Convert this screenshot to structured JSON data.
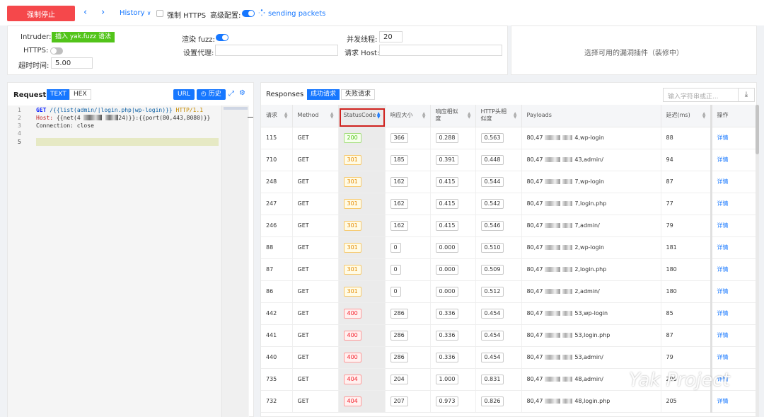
{
  "topbar": {
    "stop_label": "强制停止",
    "history_label": "History",
    "force_https_label": "强制 HTTPS",
    "advanced_label": "高级配置:",
    "sending_label": "sending packets"
  },
  "config": {
    "intruder_label": "Intruder:",
    "intruder_tag": "插入 yak.fuzz 语法",
    "https_label": "HTTPS:",
    "timeout_label": "超时时间:",
    "timeout_value": "5.00",
    "render_fuzz_label": "渲染 fuzz:",
    "proxy_label": "设置代理:",
    "proxy_value": "",
    "threads_label": "并发线程:",
    "threads_value": "20",
    "host_label": "请求 Host:",
    "host_value": "",
    "plugin_placeholder": "选择可用的漏洞插件（装修中）"
  },
  "request": {
    "title": "Request",
    "text_tab": "TEXT",
    "hex_tab": "HEX",
    "url_button": "URL",
    "history_button": "历史",
    "line_numbers": [
      "1",
      "2",
      "3",
      "4",
      "5"
    ],
    "line1_method": "GET",
    "line1_path": "/{{list(admin/|login.php|wp-login)}}",
    "line1_proto": "HTTP/1.1",
    "line2_key": "Host:",
    "line2_a": "{{net(4",
    "line2_b": "24)}}:{{port(80,443,8080)}}",
    "line3": "Connection: close"
  },
  "responses": {
    "title": "Responses",
    "success_tab": "成功请求",
    "fail_tab": "失败请求",
    "search_placeholder": "输入字符串或正...",
    "columns": [
      "请求",
      "Method",
      "StatusCode",
      "响应大小",
      "响应相似度",
      "HTTP头相似度",
      "Payloads",
      "延迟(ms)",
      "操作"
    ],
    "detail_label": "详情",
    "rows": [
      {
        "id": "115",
        "method": "GET",
        "status": "200",
        "size": "366",
        "sim": "0.288",
        "hsim": "0.563",
        "p1": "80,47",
        "p2": "4,wp-login",
        "delay": "88"
      },
      {
        "id": "710",
        "method": "GET",
        "status": "301",
        "size": "185",
        "sim": "0.391",
        "hsim": "0.448",
        "p1": "80,47",
        "p2": "43,admin/",
        "delay": "94"
      },
      {
        "id": "248",
        "method": "GET",
        "status": "301",
        "size": "162",
        "sim": "0.415",
        "hsim": "0.544",
        "p1": "80,47",
        "p2": "7,wp-login",
        "delay": "87"
      },
      {
        "id": "247",
        "method": "GET",
        "status": "301",
        "size": "162",
        "sim": "0.415",
        "hsim": "0.542",
        "p1": "80,47",
        "p2": "7,login.php",
        "delay": "77"
      },
      {
        "id": "246",
        "method": "GET",
        "status": "301",
        "size": "162",
        "sim": "0.415",
        "hsim": "0.546",
        "p1": "80,47",
        "p2": "7,admin/",
        "delay": "79"
      },
      {
        "id": "88",
        "method": "GET",
        "status": "301",
        "size": "0",
        "sim": "0.000",
        "hsim": "0.510",
        "p1": "80,47",
        "p2": "2,wp-login",
        "delay": "181"
      },
      {
        "id": "87",
        "method": "GET",
        "status": "301",
        "size": "0",
        "sim": "0.000",
        "hsim": "0.509",
        "p1": "80,47",
        "p2": "2,login.php",
        "delay": "180"
      },
      {
        "id": "86",
        "method": "GET",
        "status": "301",
        "size": "0",
        "sim": "0.000",
        "hsim": "0.512",
        "p1": "80,47",
        "p2": "2,admin/",
        "delay": "180"
      },
      {
        "id": "442",
        "method": "GET",
        "status": "400",
        "size": "286",
        "sim": "0.336",
        "hsim": "0.454",
        "p1": "80,47",
        "p2": "53,wp-login",
        "delay": "85"
      },
      {
        "id": "441",
        "method": "GET",
        "status": "400",
        "size": "286",
        "sim": "0.336",
        "hsim": "0.454",
        "p1": "80,47",
        "p2": "53,login.php",
        "delay": "87"
      },
      {
        "id": "440",
        "method": "GET",
        "status": "400",
        "size": "286",
        "sim": "0.336",
        "hsim": "0.454",
        "p1": "80,47",
        "p2": "53,admin/",
        "delay": "79"
      },
      {
        "id": "735",
        "method": "GET",
        "status": "404",
        "size": "204",
        "sim": "1.000",
        "hsim": "0.831",
        "p1": "80,47",
        "p2": "48,admin/",
        "delay": "206"
      },
      {
        "id": "732",
        "method": "GET",
        "status": "404",
        "size": "207",
        "sim": "0.973",
        "hsim": "0.826",
        "p1": "80,47",
        "p2": "48,login.php",
        "delay": "205"
      }
    ]
  },
  "watermark": "Yak Project",
  "colors": {
    "accent": "#1677ff",
    "stop": "#f5484b",
    "status200": "#52c41a",
    "status301": "#e48a00",
    "status4xx": "#f5222d",
    "highlight": "#d0221e"
  }
}
